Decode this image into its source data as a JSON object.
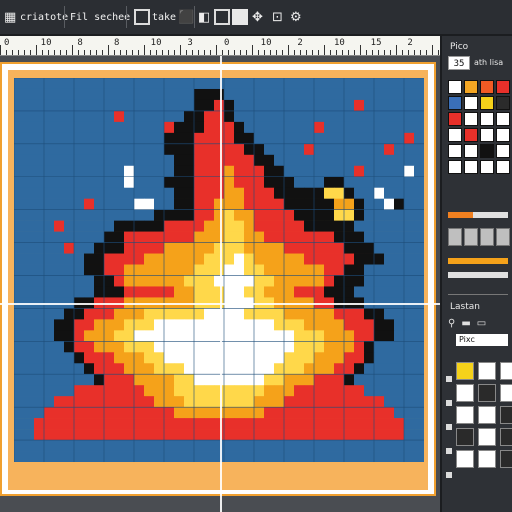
{
  "toolbar": {
    "doc_label": "criatote",
    "file_label": "Fil sechee",
    "tool_label": "take",
    "icons": [
      "brush-icon",
      "bucket-icon",
      "eyedropper-icon",
      "select-icon",
      "frame-icon",
      "move-icon",
      "settings-icon"
    ]
  },
  "ruler": {
    "labels": [
      "0",
      "10",
      "8",
      "8",
      "10",
      "3",
      "0",
      "10",
      "2",
      "10",
      "15",
      "2"
    ]
  },
  "panel": {
    "title": "Pico",
    "size_value": "35",
    "size_label": "ath lisa",
    "colors": [
      "#ffffff",
      "#f3a623",
      "#f05a24",
      "#e8302a",
      "#3a6fb8",
      "#ffffff",
      "#f5d21a",
      "#2b2b2b",
      "#e8302a",
      "#ffffff",
      "#ffffff",
      "#ffffff",
      "#ffffff",
      "#e8302a",
      "#ffffff",
      "#ffffff",
      "#ffffff",
      "#ffffff",
      "#111111",
      "#ffffff",
      "#ffffff",
      "#ffffff",
      "#ffffff",
      "#ffffff"
    ],
    "opacity_fill_pct": 42,
    "layers_title": "Lastan",
    "layer_name": "Pixc"
  },
  "canvas": {
    "palette": {
      "0": "#2f6aa0",
      "1": "#e8302a",
      "2": "#f5a21a",
      "3": "#ffd84a",
      "4": "#ffffff",
      "5": "#111111",
      "6": "#f06c2a"
    },
    "grid_rows": [
      "00000000000000000000000000000000000000000",
      "00000000000000000055500000000000000000000",
      "00000000000000000055150000000000001000000",
      "00000000001000000551150000000000000000000",
      "00000000000000015551115000000010000000000",
      "00000000000000055511115500000000000000010",
      "00000000000000055511111550000100000001000",
      "00000000000000005511111155000000000000000",
      "00000000000400005511121115500000001000040",
      "00000000000400055511121115550005500000000",
      "00000000000000005511122111555553350040000",
      "00000001000044005511222111155555225004500",
      "00000000000000555511232211115555335000000",
      "00001000005555511112233211111555550000000",
      "00000000055111111122233221111111555000000",
      "00000100555111122222333222211111155500000",
      "00000005511112222223334322222111115550000",
      "00000005511222222233344332222221155000000",
      "00000000551222222333444433222221555000000",
      "00000000555111112233344332221115550000000",
      "00000055111222222233344433222211555000000",
      "00000551112223333334444333322222111550000",
      "00005511222333444444444444333222211155000",
      "00005512223344444444444444443332221155000",
      "00000511222333444444444444443332221500000",
      "00000051112223344444444444433322211500000",
      "00000005111222333444444444333222115000000",
      "00000000511122223344444443322211150000000",
      "00000011111112223333333332221111111000000",
      "00001111111111222333333322211111111110000",
      "00011111111111112222222221111111111111000",
      "00111111111111111111111111111111111111100",
      "00111111111111111111111111111111111111100",
      "00000000000000000000000000000000000000000",
      "00000000000000000000000000000000000000000"
    ]
  }
}
